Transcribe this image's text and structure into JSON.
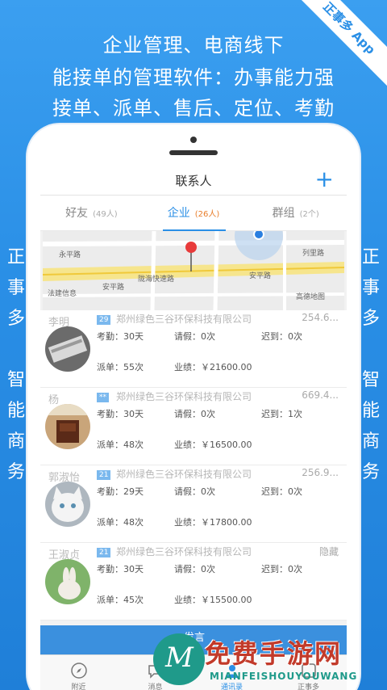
{
  "promo": {
    "ribbon": "正事多 App",
    "headline_1": "企业管理、电商线下",
    "headline_2": "能接单的管理软件：办事能力强",
    "headline_3": "接单、派单、售后、定位、考勤",
    "side_left": [
      "正",
      "事",
      "多",
      "",
      "智",
      "能",
      "商",
      "务"
    ],
    "side_right": [
      "正",
      "事",
      "多",
      "",
      "智",
      "能",
      "商",
      "务"
    ]
  },
  "navbar": {
    "title": "联系人",
    "add_icon": "plus-icon"
  },
  "tabs": [
    {
      "label": "好友",
      "count": "(49人)",
      "active": false
    },
    {
      "label": "企业",
      "count": "(26人)",
      "active": true
    },
    {
      "label": "群组",
      "count": "(2个)",
      "active": false
    }
  ],
  "map": {
    "labels": [
      "永平路",
      "安平路",
      "陇海快速路",
      "安平路",
      "法建信息",
      "高德地图",
      "列里路"
    ],
    "pin_color": "#e83b3b"
  },
  "contacts": [
    {
      "name": "李明",
      "badge": "29",
      "company": "郑州绿色三谷环保科技有限公司",
      "distance": "254.6...",
      "attendance": "考勤：30天",
      "leave": "请假：0次",
      "late": "迟到：0次",
      "dispatch": "派单：55次",
      "performance": "业绩：￥21600.00",
      "avatar": "brush-photo"
    },
    {
      "name": "杨",
      "badge": "**",
      "company": "郑州绿色三谷环保科技有限公司",
      "distance": "669.4...",
      "attendance": "考勤：30天",
      "leave": "请假：0次",
      "late": "迟到：1次",
      "dispatch": "派单：48次",
      "performance": "业绩：￥16500.00",
      "avatar": "room-photo"
    },
    {
      "name": "郭淑怡",
      "badge": "21",
      "company": "郑州绿色三谷环保科技有限公司",
      "distance": "256.9...",
      "attendance": "考勤：29天",
      "leave": "请假：0次",
      "late": "迟到：0次",
      "dispatch": "派单：48次",
      "performance": "业绩：￥17800.00",
      "avatar": "cat-photo"
    },
    {
      "name": "王淑贞",
      "badge": "21",
      "company": "郑州绿色三谷环保科技有限公司",
      "distance": "隐藏",
      "attendance": "考勤：30天",
      "leave": "请假：0次",
      "late": "迟到：0次",
      "dispatch": "派单：45次",
      "performance": "业绩：￥15500.00",
      "avatar": "rabbit-photo"
    }
  ],
  "post_button": "发言",
  "tabbar": [
    {
      "label": "附近",
      "icon": "compass-icon",
      "active": false
    },
    {
      "label": "消息",
      "icon": "chat-icon",
      "active": false
    },
    {
      "label": "通讯录",
      "icon": "contacts-icon",
      "active": true
    },
    {
      "label": "正事多",
      "icon": "app-icon",
      "active": false
    }
  ],
  "watermark": {
    "big": "免费手游网",
    "small": "MIANFEISHOUYOUWANG"
  }
}
